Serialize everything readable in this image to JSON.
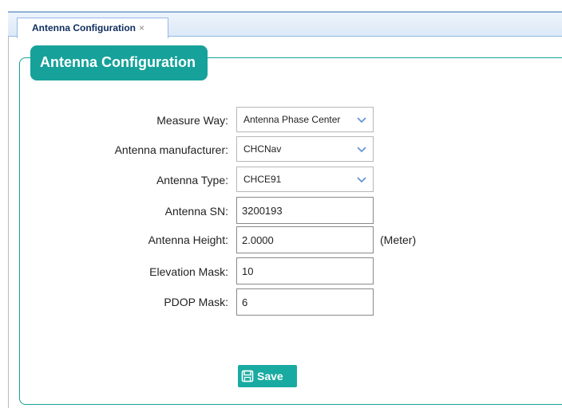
{
  "tab": {
    "label": "Antenna Configuration",
    "close": "×"
  },
  "panel": {
    "title": "Antenna Configuration"
  },
  "form": {
    "measure_way": {
      "label": "Measure Way:",
      "value": "Antenna Phase Center"
    },
    "manufacturer": {
      "label": "Antenna manufacturer:",
      "value": "CHCNav"
    },
    "antenna_type": {
      "label": "Antenna Type:",
      "value": "CHCE91"
    },
    "antenna_sn": {
      "label": "Antenna SN:",
      "value": "3200193"
    },
    "antenna_height": {
      "label": "Antenna Height:",
      "value": "2.0000",
      "unit": "(Meter)"
    },
    "elevation_mask": {
      "label": "Elevation Mask:",
      "value": "10"
    },
    "pdop_mask": {
      "label": "PDOP Mask:",
      "value": "6"
    }
  },
  "save_button": {
    "label": "Save",
    "icon": "save-icon"
  },
  "colors": {
    "accent": "#16a19a",
    "tab_border": "#95b8e7",
    "arrow": "#5b8fd6"
  }
}
